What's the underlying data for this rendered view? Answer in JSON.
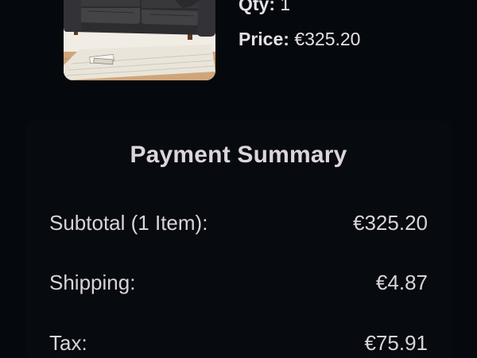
{
  "product": {
    "image_icon": "sofa-product-image",
    "qty_label": "Qty:",
    "qty_value": "1",
    "price_label": "Price:",
    "price_value": "€325.20"
  },
  "summary": {
    "title": "Payment Summary",
    "rows": [
      {
        "label": "Subtotal (1 Item):",
        "value": "€325.20"
      },
      {
        "label": "Shipping:",
        "value": "€4.87"
      },
      {
        "label": "Tax:",
        "value": "€75.91"
      }
    ]
  },
  "colors": {
    "background": "#05080c",
    "text": "#e4e0e6"
  }
}
